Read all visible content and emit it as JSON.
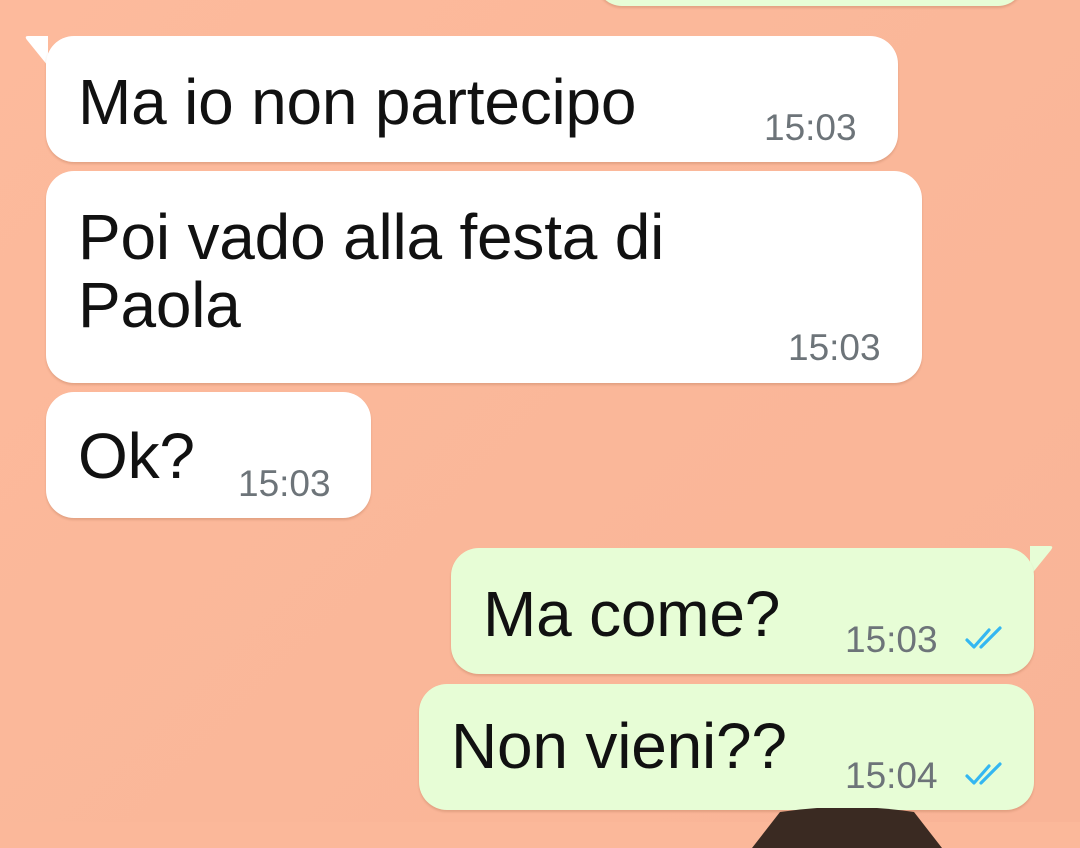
{
  "conversation": {
    "messages": [
      {
        "direction": "incoming",
        "text": "Ma io non partecipo",
        "time": "15:03"
      },
      {
        "direction": "incoming",
        "text": "Poi vado alla festa di\nPaola",
        "time": "15:03"
      },
      {
        "direction": "incoming",
        "text": "Ok?",
        "time": "15:03"
      },
      {
        "direction": "outgoing",
        "text": "Ma come?",
        "time": "15:03",
        "status": "read",
        "status_icon": "double-check-icon"
      },
      {
        "direction": "outgoing",
        "text": "Non vieni??",
        "time": "15:04",
        "status": "read",
        "status_icon": "double-check-icon"
      }
    ]
  },
  "colors": {
    "wallpaper": "#FBB89A",
    "incoming_bubble": "#FFFFFF",
    "outgoing_bubble": "#E7FDD6",
    "timestamp": "#6D7479",
    "read_ticks": "#34B7F1"
  }
}
